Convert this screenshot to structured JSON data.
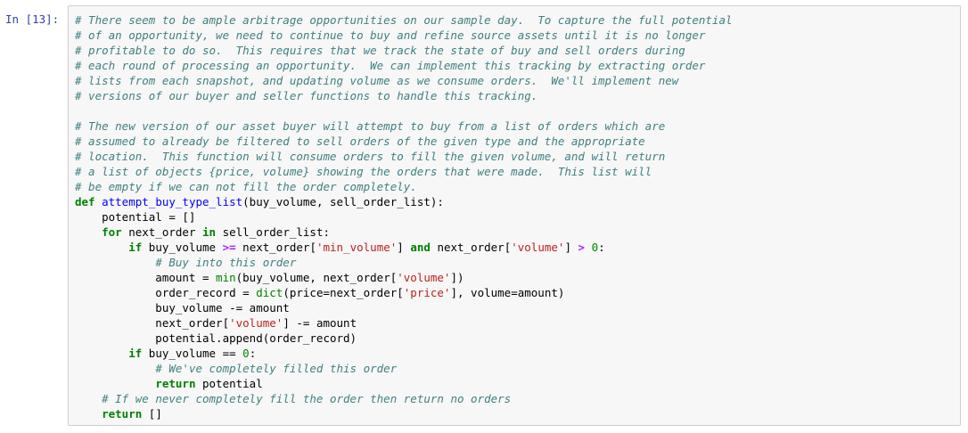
{
  "cell": {
    "prompt": "In [13]:",
    "lines": [
      [
        [
          "c",
          "# There seem to be ample arbitrage opportunities on our sample day.  To capture the full potential"
        ]
      ],
      [
        [
          "c",
          "# of an opportunity, we need to continue to buy and refine source assets until it is no longer"
        ]
      ],
      [
        [
          "c",
          "# profitable to do so.  This requires that we track the state of buy and sell orders during"
        ]
      ],
      [
        [
          "c",
          "# each round of processing an opportunity.  We can implement this tracking by extracting order"
        ]
      ],
      [
        [
          "c",
          "# lists from each snapshot, and updating volume as we consume orders.  We'll implement new"
        ]
      ],
      [
        [
          "c",
          "# versions of our buyer and seller functions to handle this tracking."
        ]
      ],
      [],
      [
        [
          "c",
          "# The new version of our asset buyer will attempt to buy from a list of orders which are"
        ]
      ],
      [
        [
          "c",
          "# assumed to already be filtered to sell orders of the given type and the appropriate"
        ]
      ],
      [
        [
          "c",
          "# location.  This function will consume orders to fill the given volume, and will return"
        ]
      ],
      [
        [
          "c",
          "# a list of objects {price, volume} showing the orders that were made.  This list will"
        ]
      ],
      [
        [
          "c",
          "# be empty if we can not fill the order completely."
        ]
      ],
      [
        [
          "k",
          "def"
        ],
        [
          "p",
          " "
        ],
        [
          "f",
          "attempt_buy_type_list"
        ],
        [
          "p",
          "(buy_volume, sell_order_list):"
        ]
      ],
      [
        [
          "p",
          "    potential = []"
        ]
      ],
      [
        [
          "p",
          "    "
        ],
        [
          "k",
          "for"
        ],
        [
          "p",
          " next_order "
        ],
        [
          "k",
          "in"
        ],
        [
          "p",
          " sell_order_list:"
        ]
      ],
      [
        [
          "p",
          "        "
        ],
        [
          "k",
          "if"
        ],
        [
          "p",
          " buy_volume "
        ],
        [
          "o",
          ">="
        ],
        [
          "p",
          " next_order["
        ],
        [
          "s",
          "'min_volume'"
        ],
        [
          "p",
          "] "
        ],
        [
          "k",
          "and"
        ],
        [
          "p",
          " next_order["
        ],
        [
          "s",
          "'volume'"
        ],
        [
          "p",
          "] "
        ],
        [
          "o",
          ">"
        ],
        [
          "p",
          " "
        ],
        [
          "n",
          "0"
        ],
        [
          "p",
          ":"
        ]
      ],
      [
        [
          "p",
          "            "
        ],
        [
          "c",
          "# Buy into this order"
        ]
      ],
      [
        [
          "p",
          "            amount = "
        ],
        [
          "b",
          "min"
        ],
        [
          "p",
          "(buy_volume, next_order["
        ],
        [
          "s",
          "'volume'"
        ],
        [
          "p",
          "])"
        ]
      ],
      [
        [
          "p",
          "            order_record = "
        ],
        [
          "b",
          "dict"
        ],
        [
          "p",
          "(price=next_order["
        ],
        [
          "s",
          "'price'"
        ],
        [
          "p",
          "], volume=amount)"
        ]
      ],
      [
        [
          "p",
          "            buy_volume -= amount"
        ]
      ],
      [
        [
          "p",
          "            next_order["
        ],
        [
          "s",
          "'volume'"
        ],
        [
          "p",
          "] -= amount"
        ]
      ],
      [
        [
          "p",
          "            potential.append(order_record)"
        ]
      ],
      [
        [
          "p",
          "        "
        ],
        [
          "k",
          "if"
        ],
        [
          "p",
          " buy_volume == "
        ],
        [
          "n",
          "0"
        ],
        [
          "p",
          ":"
        ]
      ],
      [
        [
          "p",
          "            "
        ],
        [
          "c",
          "# We've completely filled this order"
        ]
      ],
      [
        [
          "p",
          "            "
        ],
        [
          "k",
          "return"
        ],
        [
          "p",
          " potential"
        ]
      ],
      [
        [
          "p",
          "    "
        ],
        [
          "c",
          "# If we never completely fill the order then return no orders"
        ]
      ],
      [
        [
          "p",
          "    "
        ],
        [
          "k",
          "return"
        ],
        [
          "p",
          " []"
        ]
      ]
    ]
  },
  "colors": {
    "comment": "#408080",
    "keyword": "#008000",
    "function": "#0000ff",
    "string": "#ba2121",
    "number": "#008800",
    "operator": "#aa22ff",
    "prompt": "#303f9f",
    "editor_bg": "#f7f7f7",
    "editor_border": "#cfcfcf"
  }
}
